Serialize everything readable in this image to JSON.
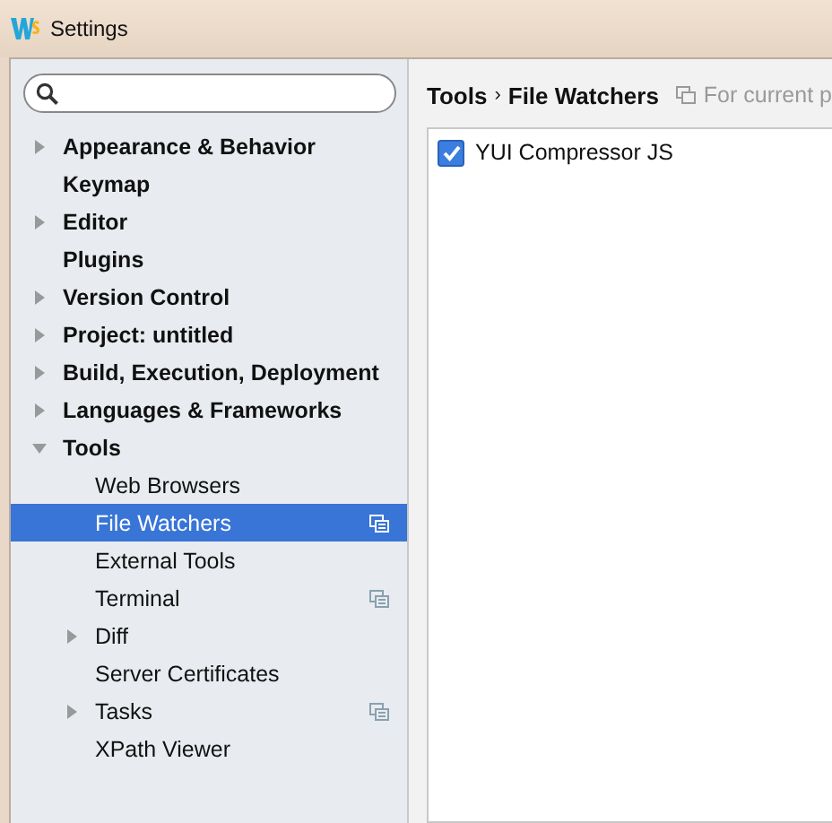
{
  "window": {
    "title": "Settings"
  },
  "tree": [
    {
      "label": "Appearance & Behavior",
      "kind": "folder",
      "expanded": false,
      "selected": false
    },
    {
      "label": "Keymap",
      "kind": "leaf",
      "selected": false
    },
    {
      "label": "Editor",
      "kind": "folder",
      "expanded": false,
      "selected": false
    },
    {
      "label": "Plugins",
      "kind": "leaf",
      "selected": false
    },
    {
      "label": "Version Control",
      "kind": "folder",
      "expanded": false,
      "selected": false
    },
    {
      "label": "Project: untitled",
      "kind": "folder",
      "expanded": false,
      "selected": false
    },
    {
      "label": "Build, Execution, Deployment",
      "kind": "folder",
      "expanded": false,
      "selected": false
    },
    {
      "label": "Languages & Frameworks",
      "kind": "folder",
      "expanded": false,
      "selected": false
    },
    {
      "label": "Tools",
      "kind": "folder",
      "expanded": true,
      "selected": false,
      "children": [
        {
          "label": "Web Browsers",
          "kind": "leaf",
          "selected": false,
          "project_level": false
        },
        {
          "label": "File Watchers",
          "kind": "leaf",
          "selected": true,
          "project_level": true
        },
        {
          "label": "External Tools",
          "kind": "leaf",
          "selected": false,
          "project_level": false
        },
        {
          "label": "Terminal",
          "kind": "leaf",
          "selected": false,
          "project_level": true
        },
        {
          "label": "Diff",
          "kind": "folder",
          "expanded": false,
          "selected": false,
          "project_level": false
        },
        {
          "label": "Server Certificates",
          "kind": "leaf",
          "selected": false,
          "project_level": false
        },
        {
          "label": "Tasks",
          "kind": "folder",
          "expanded": false,
          "selected": false,
          "project_level": true
        },
        {
          "label": "XPath Viewer",
          "kind": "leaf",
          "selected": false,
          "project_level": false
        }
      ]
    }
  ],
  "breadcrumb": {
    "parent": "Tools",
    "separator": "›",
    "current": "File Watchers",
    "scope": "For current p"
  },
  "watchers": [
    {
      "label": "YUI Compressor JS",
      "checked": true
    }
  ]
}
